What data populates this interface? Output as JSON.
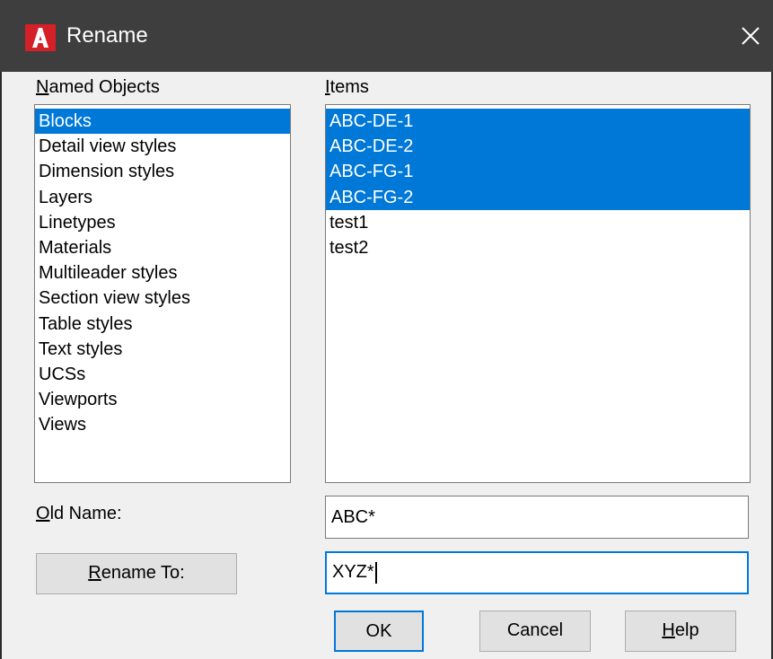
{
  "window": {
    "title": "Rename"
  },
  "named_objects": {
    "label": "Named Objects",
    "items": [
      "Blocks",
      "Detail view styles",
      "Dimension styles",
      "Layers",
      "Linetypes",
      "Materials",
      "Multileader styles",
      "Section view styles",
      "Table styles",
      "Text styles",
      "UCSs",
      "Viewports",
      "Views"
    ],
    "selected": "Blocks"
  },
  "items_list": {
    "label": "Items",
    "items": [
      "ABC-DE-1",
      "ABC-DE-2",
      "ABC-FG-1",
      "ABC-FG-2",
      "test1",
      "test2"
    ],
    "selected": [
      "ABC-DE-1",
      "ABC-DE-2",
      "ABC-FG-1",
      "ABC-FG-2"
    ]
  },
  "old_name": {
    "label": "Old Name:",
    "value": "ABC*"
  },
  "rename_to": {
    "button_label": "Rename To:",
    "value": "XYZ*"
  },
  "buttons": {
    "ok": "OK",
    "cancel": "Cancel",
    "help": "Help"
  },
  "colors": {
    "selection": "#0078d7",
    "titlebar": "#3e3e3e",
    "app_icon": "#d42027"
  },
  "icons": {
    "app": "autocad-icon",
    "close": "close-icon"
  }
}
